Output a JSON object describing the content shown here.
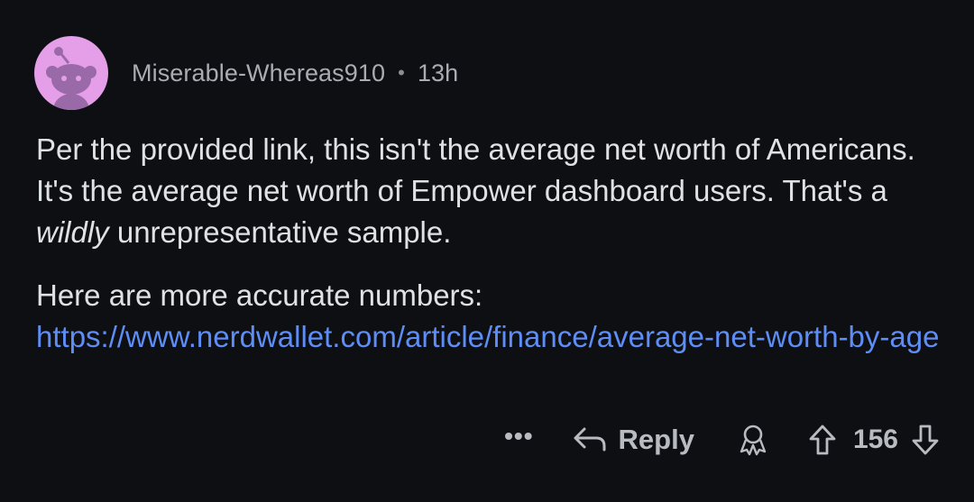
{
  "comment": {
    "author": "Miserable-Whereas910",
    "separator": "•",
    "time": "13h",
    "paragraph1": {
      "before": "Per the provided link, this isn't the average net worth of Americans. It's the average net worth of Empower dashboard users. That's a ",
      "emphasis": "wildly",
      "after": " unrepresentative sample."
    },
    "paragraph2": {
      "text": "Here are more accurate numbers: ",
      "link_text": "https://www.nerdwallet.com/article/finance/average-net-worth-by-age"
    }
  },
  "actions": {
    "more_label": "•••",
    "reply_label": "Reply",
    "vote_count": "156"
  },
  "icons": {
    "avatar": "reddit-snoo-avatar-icon",
    "reply": "reply-arrow-icon",
    "award": "award-icon",
    "upvote": "upvote-arrow-icon",
    "downvote": "downvote-arrow-icon"
  },
  "colors": {
    "background": "#0d0f13",
    "text": "#dfe2e5",
    "muted": "#a9adb2",
    "link": "#5e8ef5",
    "avatar_bg": "#e59ee8"
  }
}
